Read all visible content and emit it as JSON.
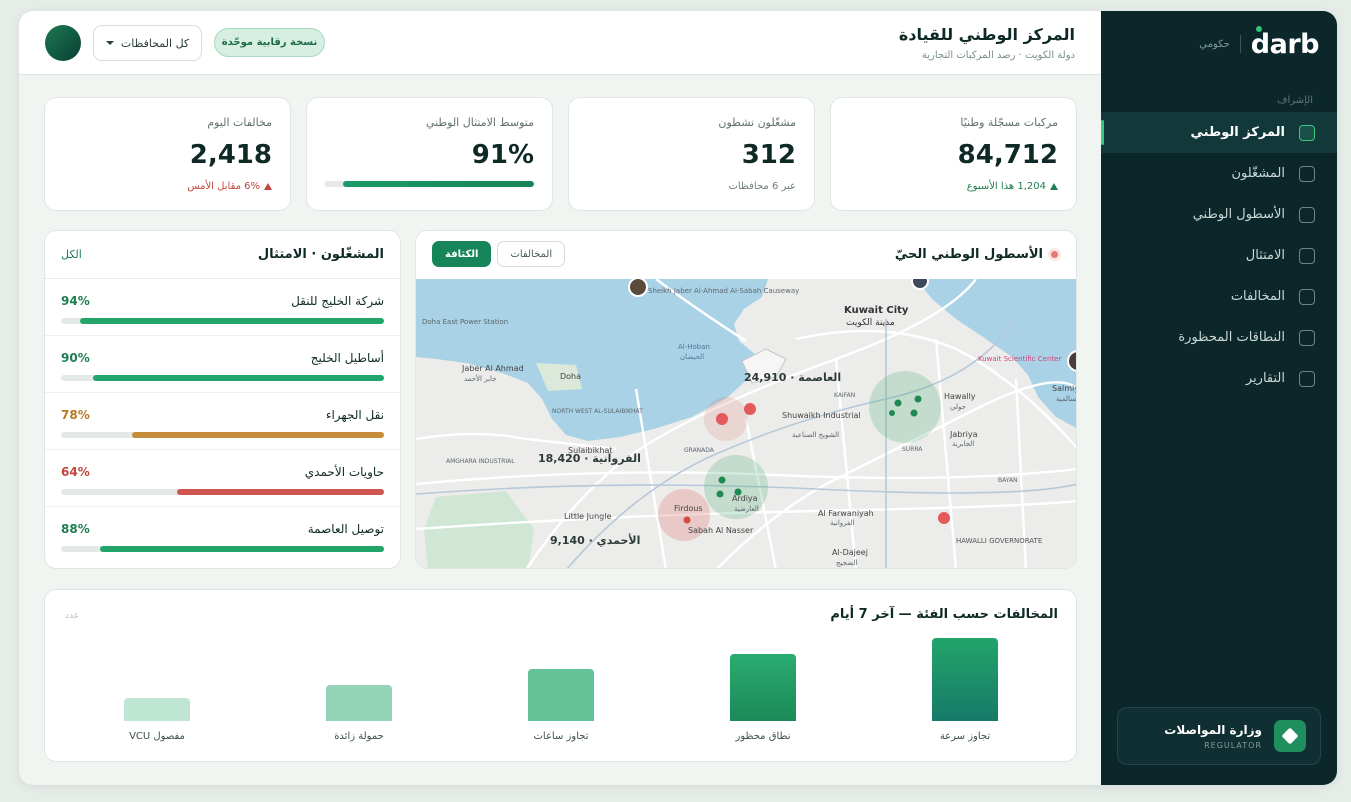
{
  "sidebar": {
    "brand": "darb",
    "brand_tag": "حكومي",
    "section_label": "الإشراف",
    "items": [
      {
        "label": "المركز الوطني",
        "active": true
      },
      {
        "label": "المشغّلون",
        "active": false
      },
      {
        "label": "الأسطول الوطني",
        "active": false
      },
      {
        "label": "الامتثال",
        "active": false
      },
      {
        "label": "المخالفات",
        "active": false
      },
      {
        "label": "النطاقات المحظورة",
        "active": false
      },
      {
        "label": "التقارير",
        "active": false
      }
    ],
    "ministry": {
      "name": "وزارة المواصلات",
      "role": "REGULATOR"
    }
  },
  "header": {
    "title": "المركز الوطني للقيادة",
    "subtitle": "دولة الكويت · رصد المركبات التجارية",
    "governorate_select": "كل المحافظات",
    "badge": "نسخة رقابية موحّدة"
  },
  "kpis": [
    {
      "label": "مركبات مسجّلة وطنيًا",
      "value": "84,712",
      "note": "1,204 هذا الأسبوع",
      "trend": "up"
    },
    {
      "label": "مشغّلون نشطون",
      "value": "312",
      "note": "عبر 6 محافظات",
      "trend": "none"
    },
    {
      "label": "متوسط الامتثال الوطني",
      "value": "91%",
      "progress": 0.91
    },
    {
      "label": "مخالفات اليوم",
      "value": "2,418",
      "note": "6% مقابل الأمس",
      "trend": "down"
    }
  ],
  "compliance": {
    "title": "المشغّلون · الامتثال",
    "all_link": "الكل",
    "operators": [
      {
        "name": "شركة الخليج للنقل",
        "percent": "94%",
        "value": 94,
        "color": "#23a46b",
        "text_color": "#1f7d52"
      },
      {
        "name": "أساطيل الخليج",
        "percent": "90%",
        "value": 90,
        "color": "#23a46b",
        "text_color": "#1f7d52"
      },
      {
        "name": "نقل الجهراء",
        "percent": "78%",
        "value": 78,
        "color": "#c78d3a",
        "text_color": "#b67a25"
      },
      {
        "name": "حاويات الأحمدي",
        "percent": "64%",
        "value": 64,
        "color": "#cf5650",
        "text_color": "#c0453e"
      },
      {
        "name": "توصيل العاصمة",
        "percent": "88%",
        "value": 88,
        "color": "#23a46b",
        "text_color": "#1f7d52"
      }
    ]
  },
  "fleet_map": {
    "title": "الأسطول الوطني الحيّ",
    "tabs": [
      {
        "label": "الكثافة",
        "active": true
      },
      {
        "label": "المخالفات",
        "active": false
      }
    ],
    "clusters": [
      {
        "label": "العاصمة · 24,910"
      },
      {
        "label": "الفروانية · 18,420"
      },
      {
        "label": "الأحمدي · 9,140"
      }
    ],
    "places": [
      "Sheikh Jaber Al-Ahmad Al-Sabah Causeway",
      "Doha East Power Station",
      "Kuwait City",
      "مدينة الكويت",
      "Al-Hoban",
      "الحيضان",
      "Jaber Al Ahmad",
      "جابر الأحمد",
      "Doha",
      "Hawally",
      "حولي",
      "Kuwait Scientific Center",
      "Salmiya",
      "السالمية",
      "Shuwaikh Industrial",
      "الشويخ الصناعية",
      "Jabriya",
      "الجابرية",
      "NORTH WEST AL-SULAIBIKHAT",
      "Sulaibikhat",
      "Ardiya",
      "العارضية",
      "Al Farwaniyah",
      "الفروانية",
      "AMGHARA INDUSTRIAL",
      "Little Jungle",
      "Firdous",
      "Sabah Al Nasser",
      "HAWALLI GOVERNORATE",
      "Al-Dajeej",
      "الضجيج",
      "KAIFAN",
      "GRANADA",
      "SURRA",
      "BAYAN"
    ]
  },
  "violations_chart": {
    "title": "المخالفات حسب الفئة — آخر 7 أيام",
    "unit": "عدد",
    "chart_data": {
      "type": "bar",
      "categories": [
        "تجاوز سرعة",
        "نطاق محظور",
        "تجاوز ساعات",
        "حمولة زائدة",
        "VCU مفصول"
      ],
      "values": [
        82,
        66,
        51,
        36,
        23
      ],
      "colors": [
        "#1b9a6a",
        "#23a46b",
        "#63c297",
        "#93d4b6",
        "#bfe6d3"
      ]
    }
  }
}
